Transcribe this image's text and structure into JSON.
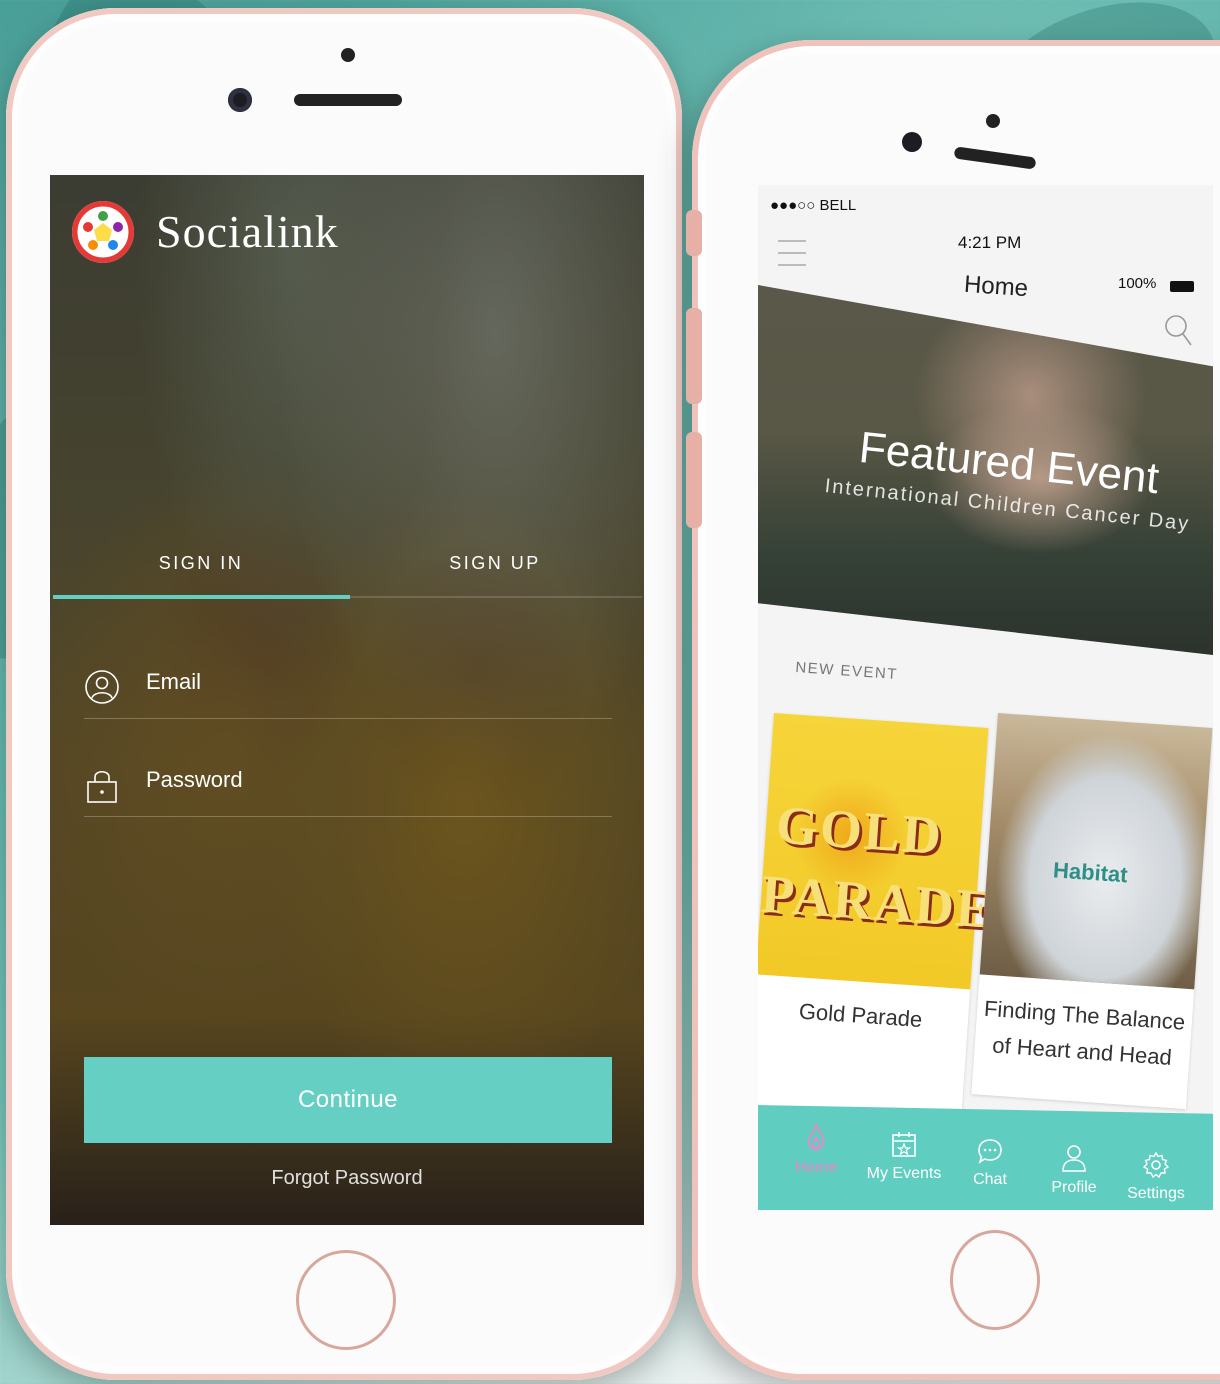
{
  "signin_screen": {
    "brand": "Socialink",
    "tabs": [
      {
        "label": "SIGN IN",
        "active": true
      },
      {
        "label": "SIGN UP",
        "active": false
      }
    ],
    "email_label": "Email",
    "password_label": "Password",
    "continue_label": "Continue",
    "forgot_label": "Forgot Password",
    "accent": "#66cfc3"
  },
  "home_screen": {
    "status": {
      "carrier": "●●●○○ BELL",
      "time": "4:21 PM",
      "battery": "100%"
    },
    "title": "Home",
    "featured": {
      "title": "Featured Event",
      "subtitle": "International Children Cancer Day"
    },
    "section_label": "NEW EVENT",
    "cards": [
      {
        "caption": "Gold Parade",
        "art_line1": "GOLD",
        "art_line2": "PARADE"
      },
      {
        "caption": "Finding The Balance of Heart and Head",
        "art_text": "Habitat"
      }
    ],
    "tabbar": [
      {
        "label": "Home",
        "icon": "flame-icon",
        "active": true
      },
      {
        "label": "My Events",
        "icon": "calendar-icon",
        "active": false
      },
      {
        "label": "Chat",
        "icon": "chat-bubble-icon",
        "active": false
      },
      {
        "label": "Profile",
        "icon": "person-icon",
        "active": false
      },
      {
        "label": "Settings",
        "icon": "gear-icon",
        "active": false
      }
    ],
    "tabbar_color": "#5fcdc0",
    "active_tab_color": "#e889c9"
  }
}
